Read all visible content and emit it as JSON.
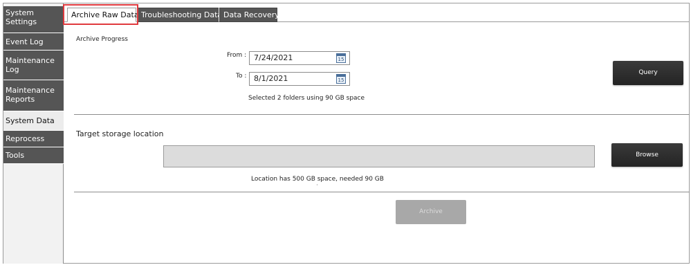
{
  "sidebar": {
    "items": [
      {
        "label": "System Settings"
      },
      {
        "label": "Event Log"
      },
      {
        "label": "Maintenance Log"
      },
      {
        "label": "Maintenance Reports"
      },
      {
        "label": "System Data"
      },
      {
        "label": "Reprocess Data"
      },
      {
        "label": "Tools"
      }
    ]
  },
  "tabs": [
    {
      "label": "Archive Raw Data"
    },
    {
      "label": "Troubleshooting Data"
    },
    {
      "label": "Data Recovery"
    }
  ],
  "archive": {
    "section_title": "Archive Progress",
    "from_label": "From :",
    "from_value": "7/24/2021",
    "to_label": "To :",
    "to_value": "8/1/2021",
    "calendar_glyph": "15",
    "query_label": "Query",
    "selected_info": "Selected 2 folders using 90 GB space"
  },
  "storage": {
    "title": "Target storage location",
    "path_value": "",
    "browse_label": "Browse",
    "space_info": "Location has 500 GB space, needed 90 GB",
    "archive_label": "Archive"
  },
  "colors": {
    "nav_bg": "#555555",
    "highlight": "#e0393e",
    "button_dark": "#2e2e2e",
    "button_disabled": "#a8a8a8"
  }
}
